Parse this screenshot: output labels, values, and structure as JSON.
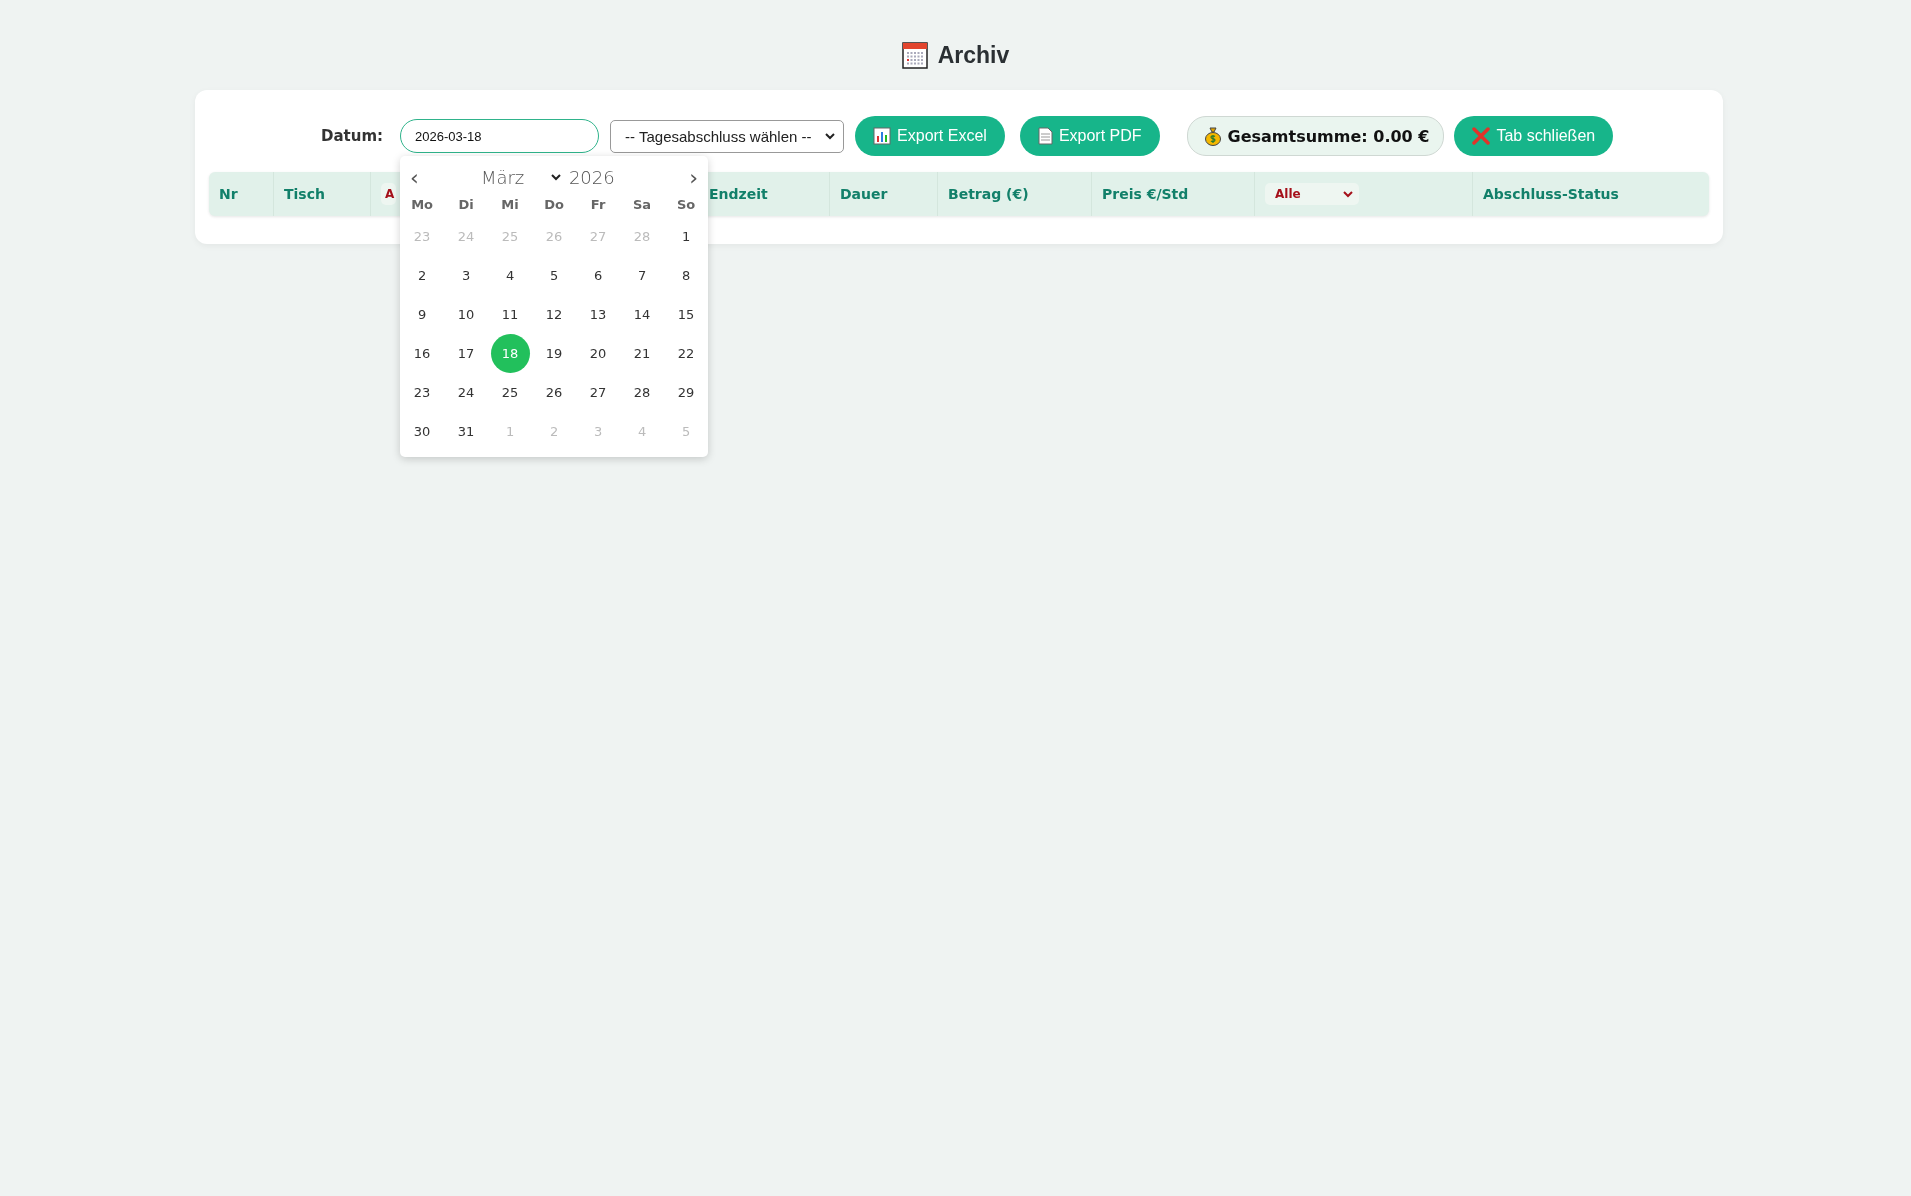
{
  "title": "Archiv",
  "toolbar": {
    "date_label": "Datum:",
    "date_value": "2026-03-18",
    "closing_select": "-- Tagesabschluss wählen --",
    "export_excel": "Export Excel",
    "export_pdf": "Export PDF",
    "total": "Gesamtsumme: 0.00 €",
    "close_tab": "Tab schließen"
  },
  "table": {
    "columns": [
      {
        "kind": "text",
        "label": "Nr"
      },
      {
        "kind": "text",
        "label": "Tisch"
      },
      {
        "kind": "filter",
        "label": "A",
        "cut": true
      },
      {
        "kind": "text",
        "label": "Endzeit"
      },
      {
        "kind": "text",
        "label": "Dauer"
      },
      {
        "kind": "text",
        "label": "Betrag (€)"
      },
      {
        "kind": "text",
        "label": "Preis €/Std"
      },
      {
        "kind": "filter",
        "label": "Alle"
      },
      {
        "kind": "text",
        "label": "Abschluss-Status"
      }
    ]
  },
  "datepicker": {
    "prev": "‹",
    "month": "März",
    "year": "2026",
    "next": "›",
    "weekdays": [
      "Mo",
      "Di",
      "Mi",
      "Do",
      "Fr",
      "Sa",
      "So"
    ],
    "days": [
      {
        "label": "23",
        "outside": true,
        "selected": false
      },
      {
        "label": "24",
        "outside": true,
        "selected": false
      },
      {
        "label": "25",
        "outside": true,
        "selected": false
      },
      {
        "label": "26",
        "outside": true,
        "selected": false
      },
      {
        "label": "27",
        "outside": true,
        "selected": false
      },
      {
        "label": "28",
        "outside": true,
        "selected": false
      },
      {
        "label": "1",
        "outside": false,
        "selected": false
      },
      {
        "label": "2",
        "outside": false,
        "selected": false
      },
      {
        "label": "3",
        "outside": false,
        "selected": false
      },
      {
        "label": "4",
        "outside": false,
        "selected": false
      },
      {
        "label": "5",
        "outside": false,
        "selected": false
      },
      {
        "label": "6",
        "outside": false,
        "selected": false
      },
      {
        "label": "7",
        "outside": false,
        "selected": false
      },
      {
        "label": "8",
        "outside": false,
        "selected": false
      },
      {
        "label": "9",
        "outside": false,
        "selected": false
      },
      {
        "label": "10",
        "outside": false,
        "selected": false
      },
      {
        "label": "11",
        "outside": false,
        "selected": false
      },
      {
        "label": "12",
        "outside": false,
        "selected": false
      },
      {
        "label": "13",
        "outside": false,
        "selected": false
      },
      {
        "label": "14",
        "outside": false,
        "selected": false
      },
      {
        "label": "15",
        "outside": false,
        "selected": false
      },
      {
        "label": "16",
        "outside": false,
        "selected": false
      },
      {
        "label": "17",
        "outside": false,
        "selected": false
      },
      {
        "label": "18",
        "outside": false,
        "selected": true
      },
      {
        "label": "19",
        "outside": false,
        "selected": false
      },
      {
        "label": "20",
        "outside": false,
        "selected": false
      },
      {
        "label": "21",
        "outside": false,
        "selected": false
      },
      {
        "label": "22",
        "outside": false,
        "selected": false
      },
      {
        "label": "23",
        "outside": false,
        "selected": false
      },
      {
        "label": "24",
        "outside": false,
        "selected": false
      },
      {
        "label": "25",
        "outside": false,
        "selected": false
      },
      {
        "label": "26",
        "outside": false,
        "selected": false
      },
      {
        "label": "27",
        "outside": false,
        "selected": false
      },
      {
        "label": "28",
        "outside": false,
        "selected": false
      },
      {
        "label": "29",
        "outside": false,
        "selected": false
      },
      {
        "label": "30",
        "outside": false,
        "selected": false
      },
      {
        "label": "31",
        "outside": false,
        "selected": false
      },
      {
        "label": "1",
        "outside": true,
        "selected": false
      },
      {
        "label": "2",
        "outside": true,
        "selected": false
      },
      {
        "label": "3",
        "outside": true,
        "selected": false
      },
      {
        "label": "4",
        "outside": true,
        "selected": false
      },
      {
        "label": "5",
        "outside": true,
        "selected": false
      }
    ]
  }
}
